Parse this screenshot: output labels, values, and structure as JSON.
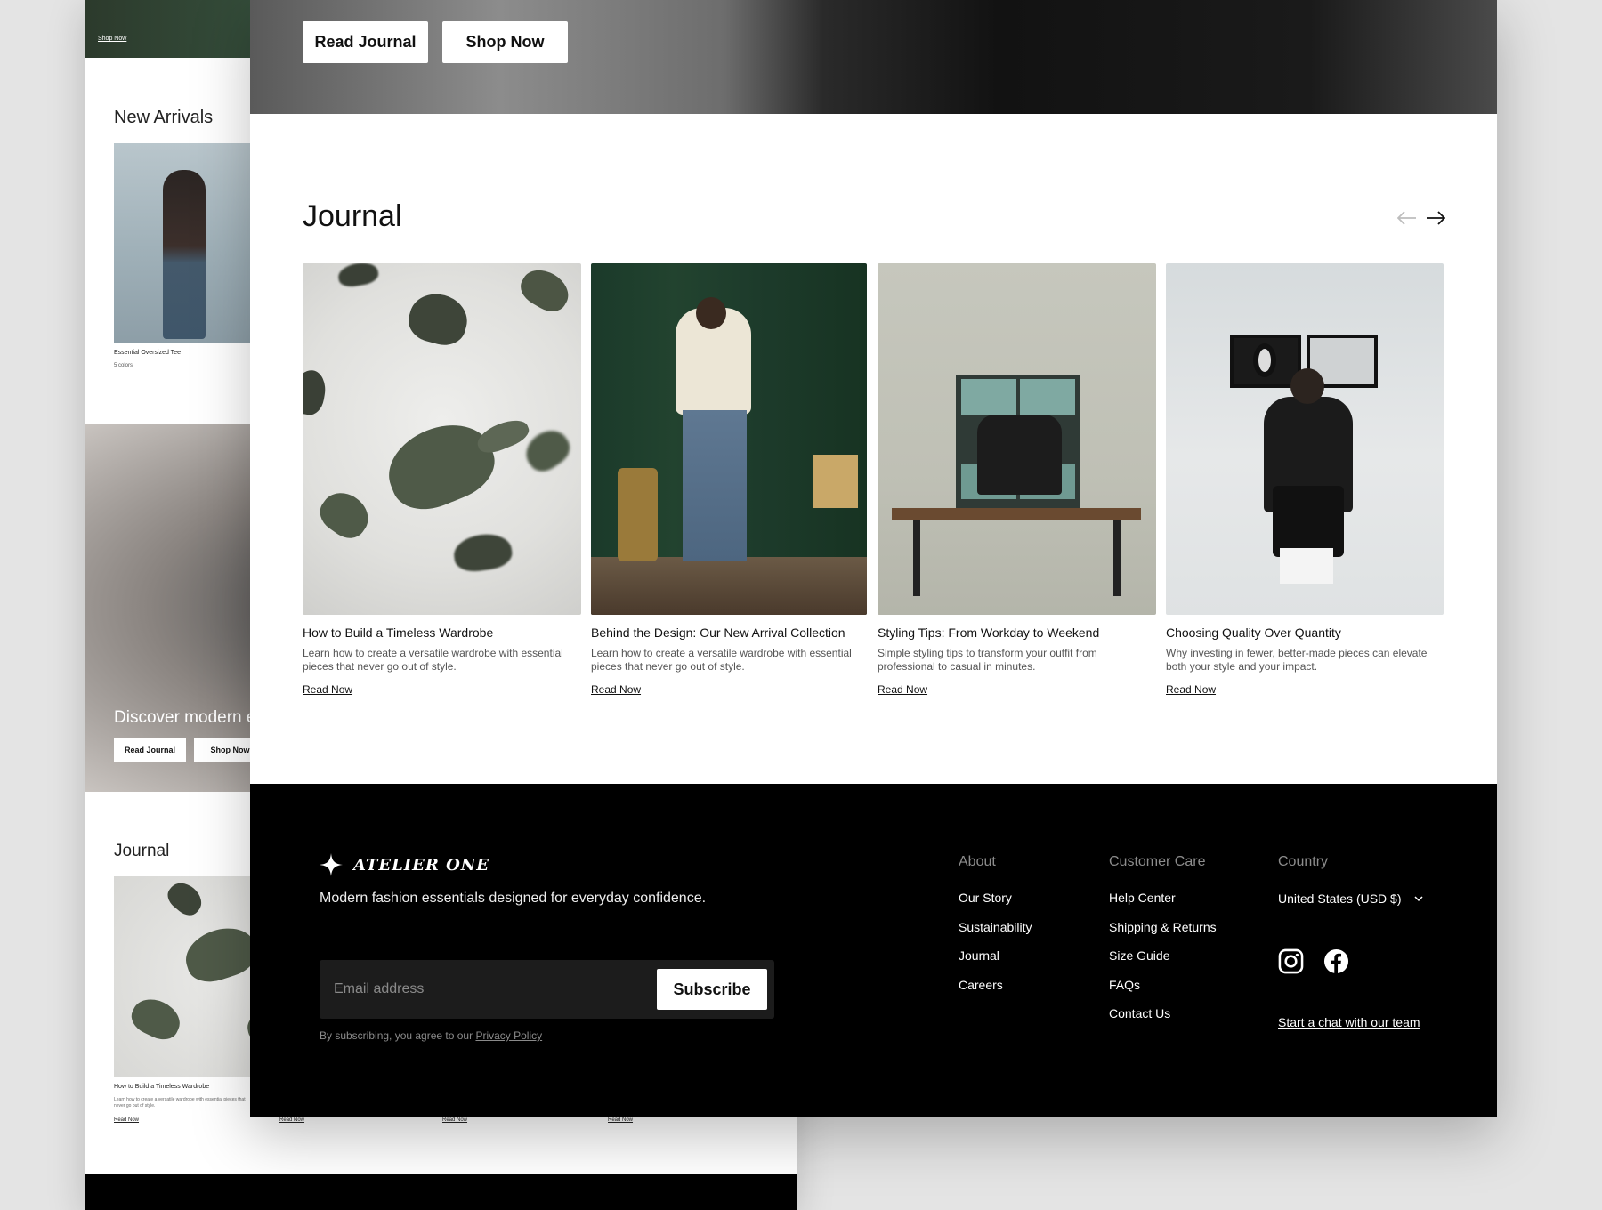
{
  "back_page": {
    "hero_link": "Shop Now",
    "new_arrivals_title": "New Arrivals",
    "product_name": "Essential Oversized Tee",
    "product_colors": "5 colors",
    "discover_text": "Discover modern e",
    "read_journal": "Read Journal",
    "shop_now": "Shop Now",
    "journal_title": "Journal",
    "journal_card_title": "How to Build a Timeless Wardrobe",
    "journal_card_desc": "Learn how to create a versatile wardrobe with essential pieces that never go out of style.",
    "read_now_links": [
      "Read Now",
      "Read Now",
      "Read Now",
      "Read Now"
    ]
  },
  "hero": {
    "read_journal": "Read Journal",
    "shop_now": "Shop Now"
  },
  "journal": {
    "title": "Journal",
    "prev_icon": "arrow-left-icon",
    "next_icon": "arrow-right-icon",
    "cards": [
      {
        "title": "How to Build a Timeless Wardrobe",
        "desc": "Learn how to create a versatile wardrobe with essential pieces that never go out of style.",
        "link": "Read Now"
      },
      {
        "title": "Behind the Design: Our New Arrival Collection",
        "desc": "Learn how to create a versatile wardrobe with essential pieces that never go out of style.",
        "link": "Read Now"
      },
      {
        "title": "Styling Tips: From Workday to Weekend",
        "desc": "Simple styling tips to transform your outfit from professional to casual in minutes.",
        "link": "Read Now"
      },
      {
        "title": "Choosing Quality Over Quantity",
        "desc": "Why investing in fewer, better-made pieces can elevate both your style and your impact.",
        "link": "Read Now"
      }
    ]
  },
  "footer": {
    "brand": "ATELIER ONE",
    "tagline": "Modern fashion essentials designed for everyday confidence.",
    "email_placeholder": "Email address",
    "subscribe": "Subscribe",
    "consent": "By subscribing, you agree to our",
    "privacy_link": "Privacy Policy",
    "about": {
      "heading": "About",
      "items": [
        "Our Story",
        "Sustainability",
        "Journal",
        "Careers"
      ]
    },
    "care": {
      "heading": "Customer Care",
      "items": [
        "Help Center",
        "Shipping & Returns",
        "Size Guide",
        "FAQs",
        "Contact Us"
      ]
    },
    "country": {
      "heading": "Country",
      "selected": "United States (USD $)"
    },
    "social_icons": [
      "instagram-icon",
      "facebook-icon"
    ],
    "chat_link": "Start a chat with our team"
  },
  "colors": {
    "footer_bg": "#000000",
    "page_bg": "#e4e4e4",
    "accent": "#111111"
  }
}
